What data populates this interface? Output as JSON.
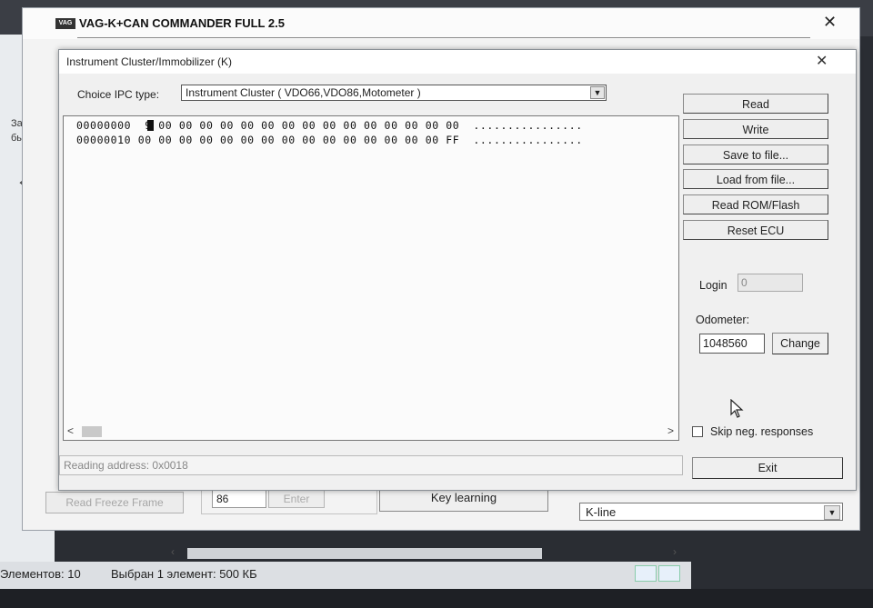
{
  "commander": {
    "title": "VAG-K+CAN COMMANDER FULL 2.5",
    "logo": "VAG",
    "freeze_frame_label": "Read Freeze Frame",
    "value_field": "86",
    "enter_label": "Enter",
    "key_learning_label": "Key learning",
    "interface_selected": "K-line"
  },
  "explorer": {
    "side_text_1": "Закр",
    "side_text_2": "бы",
    "status_count": "Элементов: 10",
    "status_selected": "Выбран 1 элемент: 500 КБ"
  },
  "dialog": {
    "title": "Instrument Cluster/Immobilizer (K)",
    "ipc_label": "Choice IPC type:",
    "ipc_selected": "Instrument Cluster ( VDO66,VDO86,Motometer )",
    "hex_rows": [
      "00000000  9 00 00 00 00 00 00 00 00 00 00 00 00 00 00 00  ................",
      "00000010 00 00 00 00 00 00 00 00 00 00 00 00 00 00 00 FF  ................"
    ],
    "status_text": "Reading address: 0x0018",
    "buttons": {
      "read": "Read",
      "write": "Write",
      "save": "Save to file...",
      "load": "Load from file...",
      "read_rom": "Read ROM/Flash",
      "reset_ecu": "Reset ECU",
      "change": "Change",
      "exit": "Exit"
    },
    "login_label": "Login",
    "login_value": "0",
    "odometer_label": "Odometer:",
    "odometer_value": "1048560",
    "skip_label": "Skip neg. responses"
  }
}
